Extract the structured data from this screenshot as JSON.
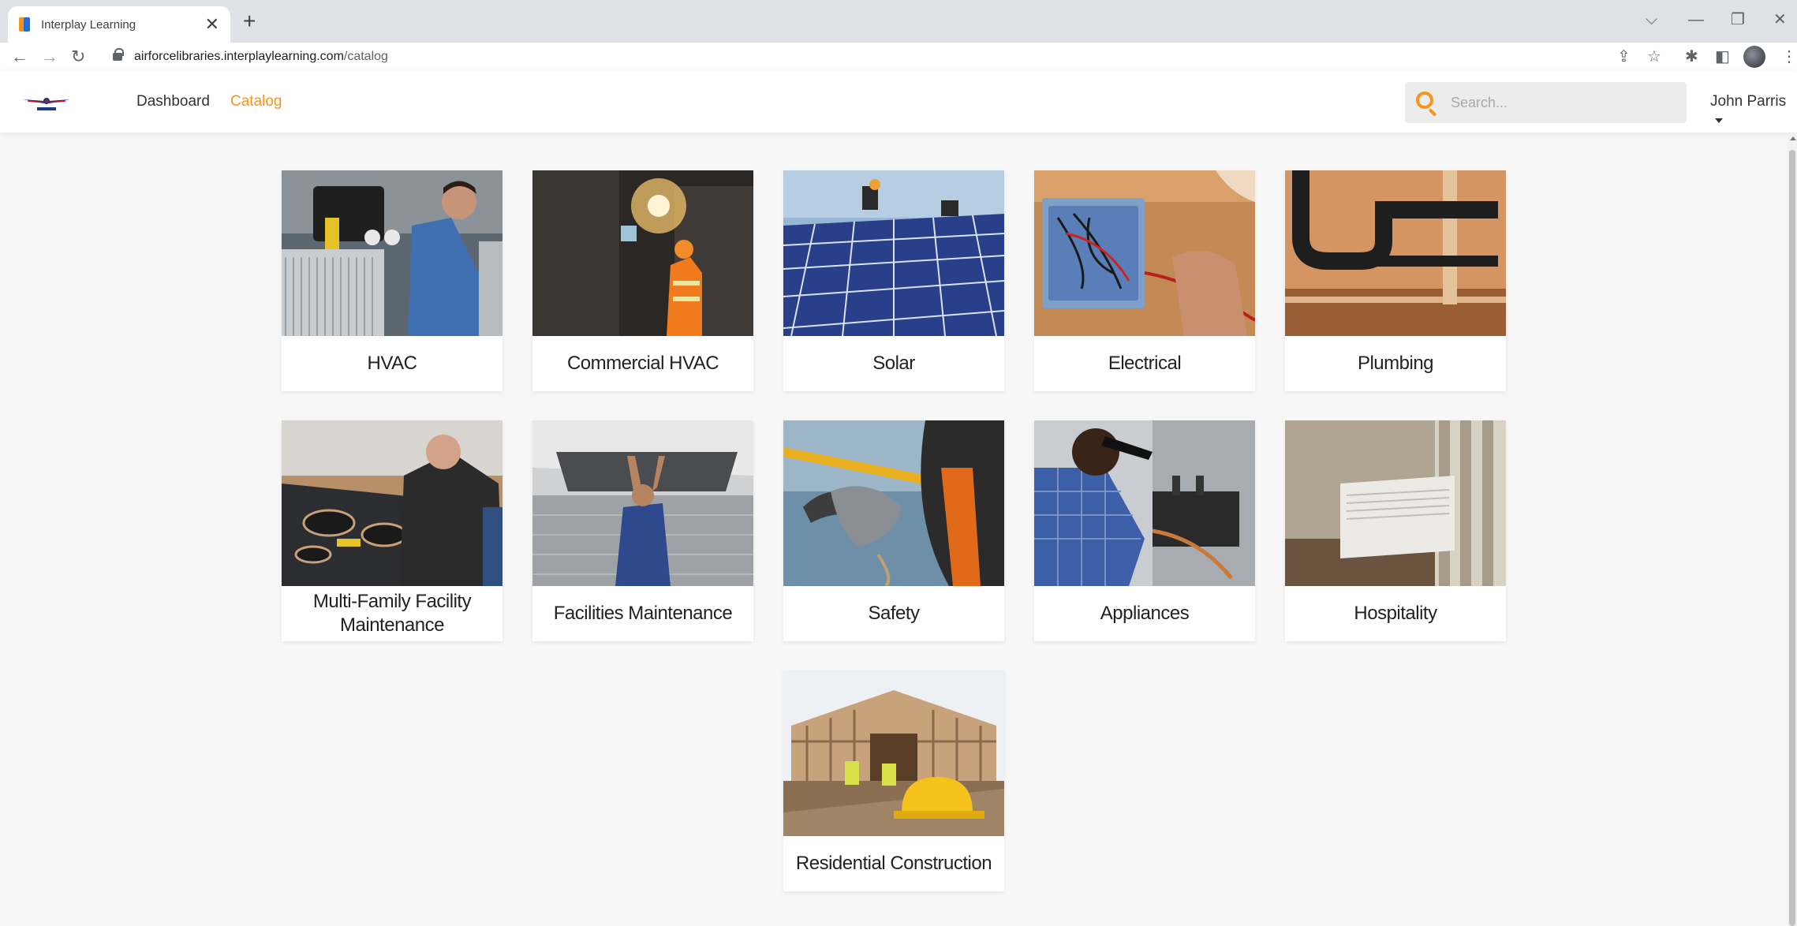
{
  "browser": {
    "tab_title": "Interplay Learning",
    "tab_close": "✕",
    "new_tab": "+",
    "url_host": "airforcelibraries.interplaylearning.com",
    "url_path": "/catalog",
    "window_controls": {
      "dropdown": "⌵",
      "minimize": "—",
      "restore": "❐",
      "close": "✕"
    }
  },
  "app": {
    "nav": {
      "dashboard": "Dashboard",
      "catalog": "Catalog"
    },
    "search": {
      "placeholder": "Search..."
    },
    "user": {
      "name": "John Parris"
    },
    "colors": {
      "accent": "#f7941d",
      "nav_text": "#333333"
    }
  },
  "catalog": {
    "items": [
      {
        "label": "HVAC",
        "image": "hvac-technician-photo"
      },
      {
        "label": "Commercial HVAC",
        "image": "commercial-hvac-photo"
      },
      {
        "label": "Solar",
        "image": "solar-panels-photo"
      },
      {
        "label": "Electrical",
        "image": "electrical-box-photo"
      },
      {
        "label": "Plumbing",
        "image": "plumbing-pipes-photo"
      },
      {
        "label": "Multi-Family Facility Maintenance",
        "image": "stove-repair-photo"
      },
      {
        "label": "Facilities Maintenance",
        "image": "ceiling-maintenance-photo"
      },
      {
        "label": "Safety",
        "image": "safety-harness-photo"
      },
      {
        "label": "Appliances",
        "image": "appliance-repair-photo"
      },
      {
        "label": "Hospitality",
        "image": "ptac-unit-photo"
      },
      {
        "label": "Residential Construction",
        "image": "construction-site-photo"
      }
    ]
  }
}
